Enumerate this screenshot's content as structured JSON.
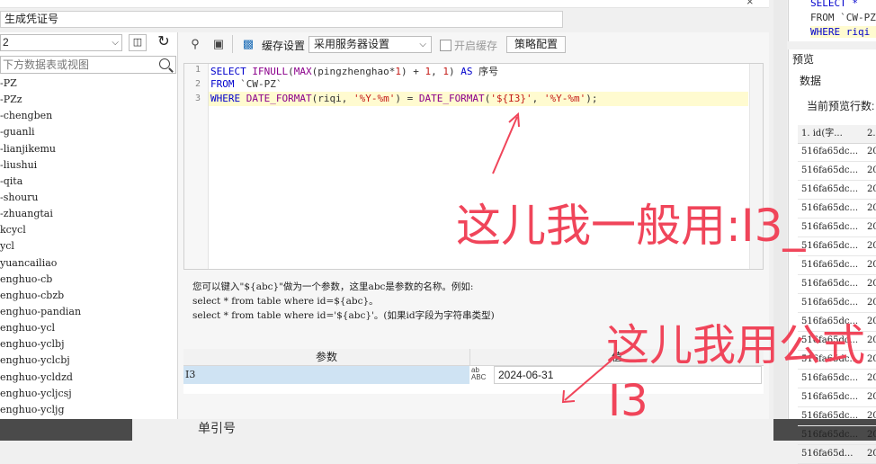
{
  "window": {
    "name_value": "生成凭证号",
    "close_glyph": "×"
  },
  "left_panel": {
    "datasource": "2",
    "search_placeholder": "下方数据表或视图",
    "tables": [
      "-PZ",
      "-PZz",
      "-chengben",
      "-guanli",
      "-lianjikemu",
      "-liushui",
      "-qita",
      "-shouru",
      "-zhuangtai",
      "kcycl",
      "ycl",
      "yuancailiao",
      "enghuo-cb",
      "enghuo-cbzb",
      "enghuo-pandian",
      "enghuo-ycl",
      "enghuo-yclbj",
      "enghuo-yclcbj",
      "enghuo-ycldzd",
      "enghuo-ycljcsj",
      "enghuo-ycljg"
    ]
  },
  "toolbar": {
    "cache_label": "缓存设置",
    "cache_option": "采用服务器设置",
    "enable_cache_label": "开启缓存",
    "strategy_button": "策略配置"
  },
  "editor": {
    "line_numbers": [
      "1",
      "2",
      "3"
    ],
    "line1": {
      "kw1": "SELECT ",
      "fn1": "IFNULL",
      "p1": "(",
      "fn2": "MAX",
      "p2": "(pingzhenghao*",
      "n1": "1",
      ")1": ") + ",
      "n2": "1",
      ")2": ", ",
      "n3": "1",
      ")3": ") ",
      "kw2": "AS",
      "rest": " 序号"
    },
    "line2": {
      "kw": "FROM ",
      "rest": "`CW-PZ`"
    },
    "line3": {
      "kw": "WHERE ",
      "fn1": "DATE_FORMAT",
      "a": "(riqi, ",
      "s1": "'%Y-%m'",
      "b": ") = ",
      "fn2": "DATE_FORMAT",
      "c": "(",
      "s2": "'${I3}'",
      "d": ", ",
      "s3": "'%Y-%m'",
      "e": ");"
    }
  },
  "help": {
    "line1": "您可以键入\"${abc}\"做为一个参数，这里abc是参数的名称。例如:",
    "line2": "select * from table where id=${abc}。",
    "line3": "select * from table where id='${abc}'。(如果id字段为字符串类型)"
  },
  "params": {
    "header_param": "参数",
    "header_value": "值",
    "row_name": "I3",
    "row_type": "ab\nABC",
    "row_value": "2024-06-31"
  },
  "behind_text": "单引号",
  "right_panel": {
    "sql_lines": [
      "SELECT *",
      "FROM `CW-PZ",
      "WHERE riqi"
    ],
    "title": "预览",
    "data_label": "数据",
    "count_label": "当前预览行数:",
    "col1": "1. id(字...",
    "col2": "2.",
    "rows": [
      "516fa65dc...",
      "516fa65dc...",
      "516fa65dc...",
      "516fa65dc...",
      "516fa65dc...",
      "516fa65dc...",
      "516fa65dc...",
      "516fa65dc...",
      "516fa65dc...",
      "516fa65dc...",
      "516fa65dc...",
      "516fa65dc...",
      "516fa65dc...",
      "516fa65dc...",
      "516fa65dc...",
      "516fa65dc...",
      "516fa65d..."
    ],
    "col2_value": "20"
  },
  "annotations": {
    "top": "这儿我一般用:I3_",
    "bottom1": "这儿我用公式",
    "bottom2": "I3",
    "color": "#f0455a"
  }
}
